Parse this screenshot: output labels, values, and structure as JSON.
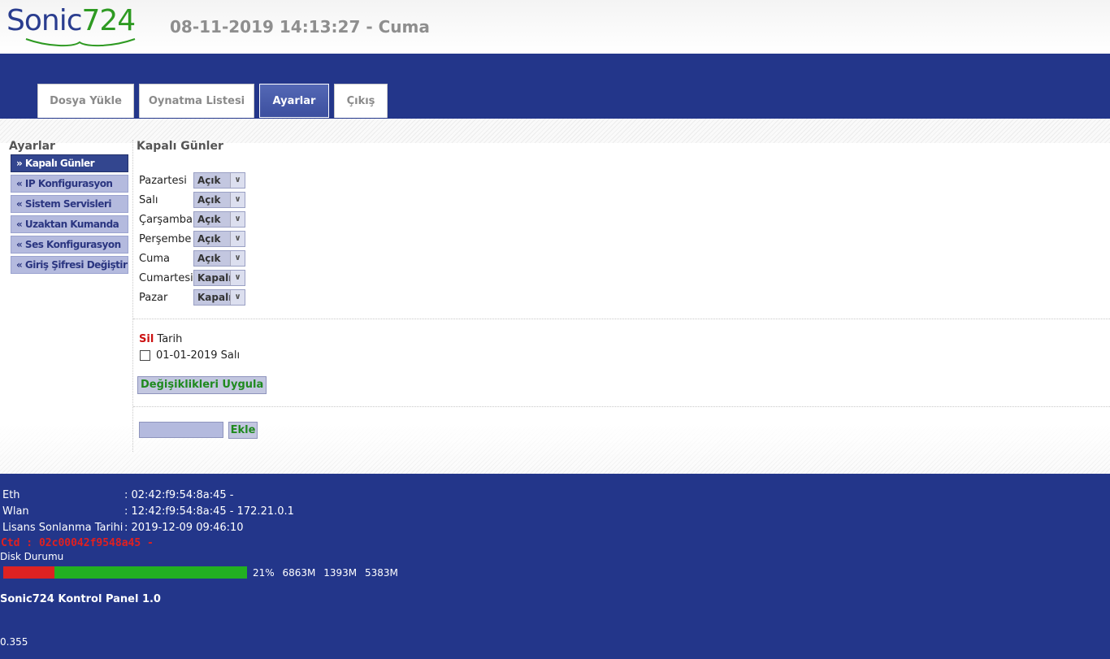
{
  "brand": {
    "logo_text_a": "Sonic",
    "logo_text_b": "724"
  },
  "header": {
    "datetime": "08-11-2019 14:13:27 - Cuma"
  },
  "nav": {
    "tabs": [
      {
        "label": "Dosya Yükle",
        "active": false
      },
      {
        "label": "Oynatma Listesi",
        "active": false
      },
      {
        "label": "Ayarlar",
        "active": true
      },
      {
        "label": "Çıkış",
        "active": false
      }
    ]
  },
  "sidebar": {
    "title": "Ayarlar",
    "items": [
      {
        "label": "» Kapalı Günler",
        "active": true
      },
      {
        "label": "« IP Konfigurasyon",
        "active": false
      },
      {
        "label": "« Sistem Servisleri",
        "active": false
      },
      {
        "label": "« Uzaktan Kumanda",
        "active": false
      },
      {
        "label": "« Ses Konfigurasyon",
        "active": false
      },
      {
        "label": "« Giriş Şifresi Değiştir",
        "active": false
      }
    ]
  },
  "main": {
    "title": "Kapalı Günler",
    "days": [
      {
        "day": "Pazartesi",
        "value": "Açık"
      },
      {
        "day": "Salı",
        "value": "Açık"
      },
      {
        "day": "Çarşamba",
        "value": "Açık"
      },
      {
        "day": "Perşembe",
        "value": "Açık"
      },
      {
        "day": "Cuma",
        "value": "Açık"
      },
      {
        "day": "Cumartesi",
        "value": "Kapalı"
      },
      {
        "day": "Pazar",
        "value": "Kapalı"
      }
    ],
    "delete_header": "Sil",
    "date_header": "Tarih",
    "dates": [
      {
        "date": "01-01-2019 Salı",
        "checked": false
      }
    ],
    "apply_label": "Değişiklikleri Uygula",
    "add_value": "",
    "add_label": "Ekle"
  },
  "footer": {
    "info": [
      {
        "key": "Eth",
        "value": ": 02:42:f9:54:8a:45 -"
      },
      {
        "key": "Wlan",
        "value": ": 12:42:f9:54:8a:45 - 172.21.0.1"
      },
      {
        "key": "Lisans Sonlanma Tarihi",
        "value": ": 2019-12-09 09:46:10"
      }
    ],
    "ctd": "Ctd : 02c00042f9548a45 -",
    "disk_label": "Disk Durumu",
    "disk_used_fraction": 0.21,
    "disk_percent": "21%",
    "disk_total": "6863M",
    "disk_used": "1393M",
    "disk_free": "5383M",
    "panel_name": "Sonic724 Kontrol Panel 1.0",
    "version": "0.355"
  },
  "colors": {
    "navy": "#23368a",
    "tab_active": "#4457a6",
    "sidebar_item": "#b4bade",
    "green_text": "#1f8a1f",
    "delete_red": "#cc1111",
    "disk_used": "#dd2222",
    "disk_free": "#22b022"
  }
}
